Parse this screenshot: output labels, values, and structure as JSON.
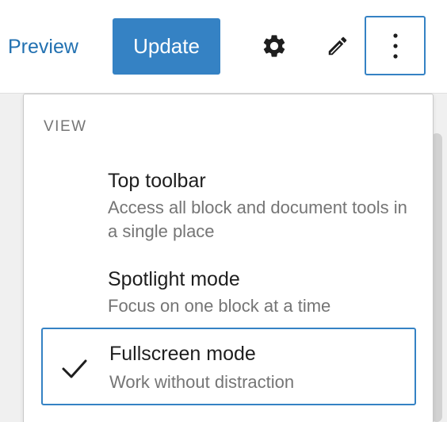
{
  "header": {
    "preview_label": "Preview",
    "update_label": "Update",
    "icons": [
      "gear-icon",
      "pencil-icon",
      "more-vertical-icon"
    ]
  },
  "menu": {
    "heading": "VIEW",
    "items": [
      {
        "label": "Top toolbar",
        "description": "Access all block and document tools in a single place",
        "checked": false
      },
      {
        "label": "Spotlight mode",
        "description": "Focus on one block at a time",
        "checked": false
      },
      {
        "label": "Fullscreen mode",
        "description": "Work without distraction",
        "checked": true
      }
    ]
  },
  "colors": {
    "accent": "#3582c4",
    "link": "#2271b1",
    "text": "#1e1e1e",
    "muted": "#757575"
  }
}
